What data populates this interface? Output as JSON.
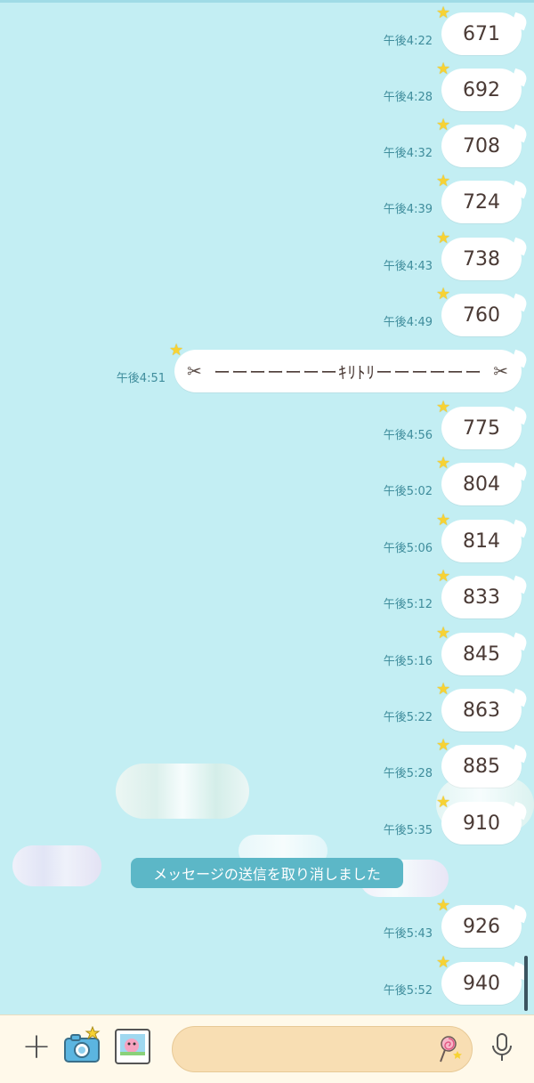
{
  "messages": [
    {
      "time": "午後4:22",
      "text": "671"
    },
    {
      "time": "午後4:28",
      "text": "692"
    },
    {
      "time": "午後4:32",
      "text": "708"
    },
    {
      "time": "午後4:39",
      "text": "724"
    },
    {
      "time": "午後4:43",
      "text": "738"
    },
    {
      "time": "午後4:49",
      "text": "760"
    },
    {
      "time": "午後4:51",
      "text": "ーーーーーーーｷﾘﾄﾘーーーーーー"
    },
    {
      "time": "午後4:56",
      "text": "775"
    },
    {
      "time": "午後5:02",
      "text": "804"
    },
    {
      "time": "午後5:06",
      "text": "814"
    },
    {
      "time": "午後5:12",
      "text": "833"
    },
    {
      "time": "午後5:16",
      "text": "845"
    },
    {
      "time": "午後5:22",
      "text": "863"
    },
    {
      "time": "午後5:28",
      "text": "885"
    },
    {
      "time": "午後5:35",
      "text": "910"
    },
    {
      "time": "午後5:43",
      "text": "926"
    },
    {
      "time": "午後5:52",
      "text": "940"
    }
  ],
  "notice": "メッセージの送信を取り消しました",
  "icons": {
    "scissors": "✂",
    "star": "★",
    "plus": "+"
  },
  "input": {
    "placeholder": ""
  },
  "colors": {
    "background": "#c3eef3",
    "time_text": "#3f8d9c",
    "notice_bg": "#5cb7c7",
    "input_bg": "#f8deb3",
    "star": "#f7d234"
  }
}
